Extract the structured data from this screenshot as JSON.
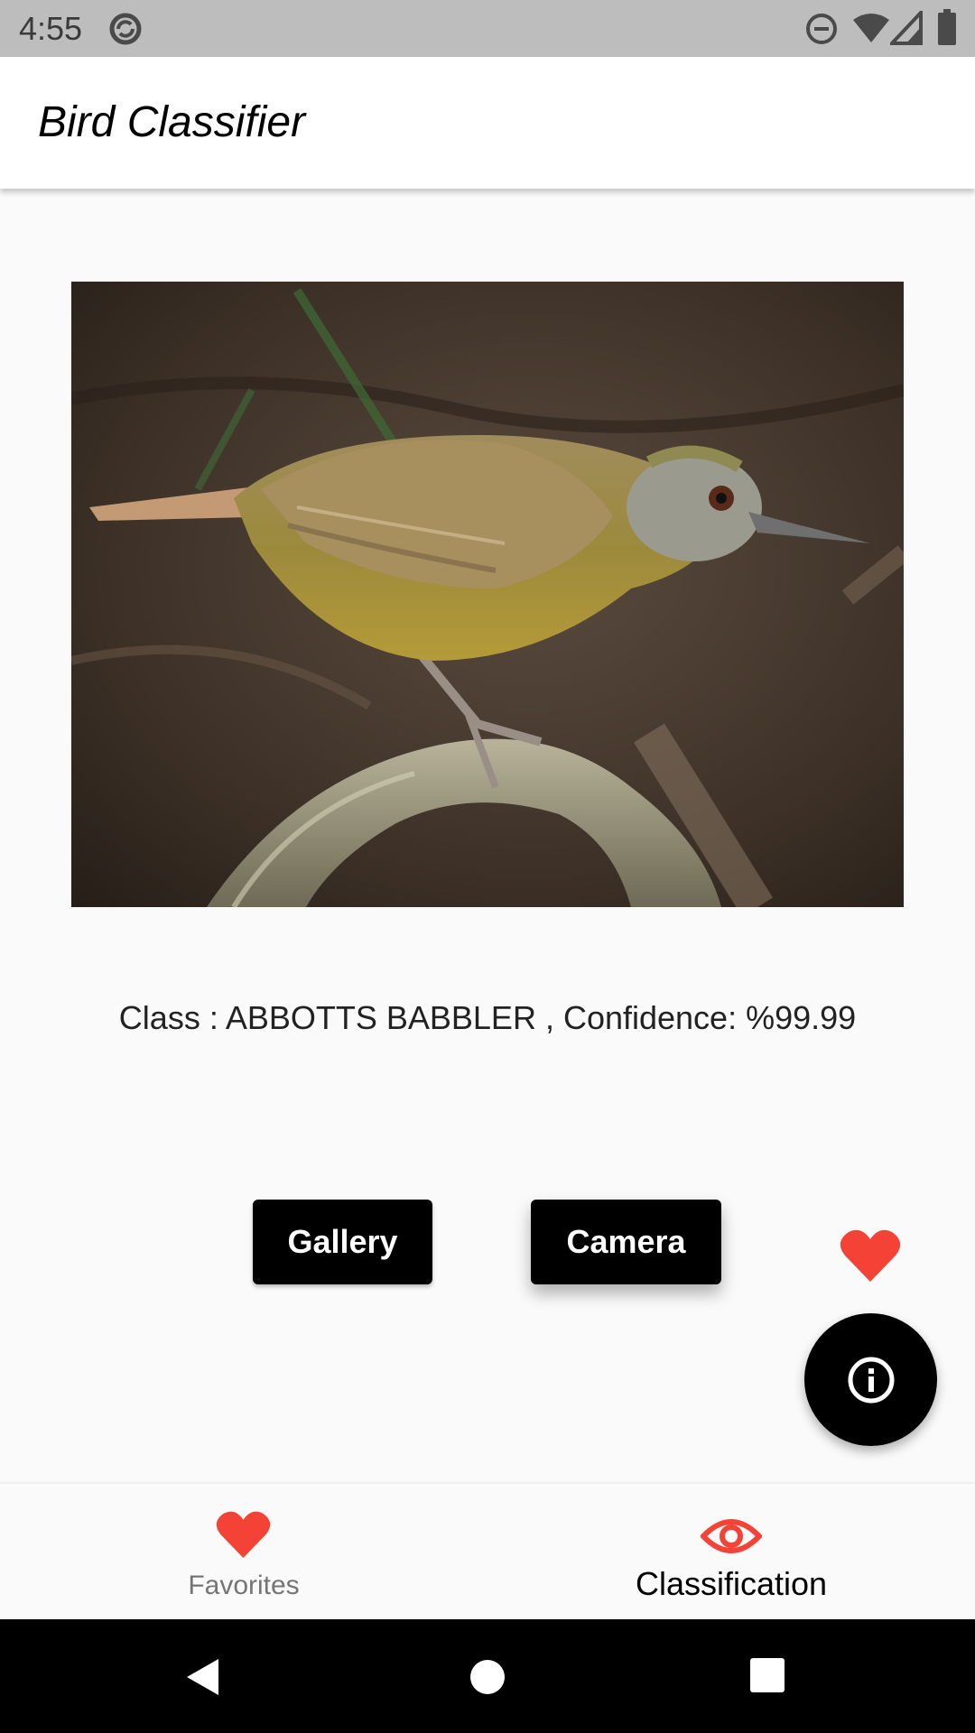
{
  "status_bar": {
    "time": "4:55",
    "icons": [
      "do-not-disturb-icon",
      "wifi-icon",
      "signal-icon",
      "battery-icon",
      "sync-icon"
    ]
  },
  "app_bar": {
    "title": "Bird Classifier"
  },
  "main": {
    "image_icon": "bird-photo",
    "result_text": "Class : ABBOTTS BABBLER , Confidence: %99.99",
    "gallery_label": "Gallery",
    "camera_label": "Camera",
    "favorite_icon": "heart-icon",
    "info_icon": "info-icon"
  },
  "bottom_nav": {
    "items": [
      {
        "label": "Favorites",
        "icon": "heart-icon",
        "selected": false
      },
      {
        "label": "Classification",
        "icon": "eye-icon",
        "selected": true
      }
    ]
  },
  "system_nav": {
    "icons": [
      "back-icon",
      "home-icon",
      "recents-icon"
    ]
  },
  "colors": {
    "accent_red": "#f44336",
    "status_bar": "#bdbdbd",
    "background": "#fafafa",
    "button": "#000000"
  }
}
